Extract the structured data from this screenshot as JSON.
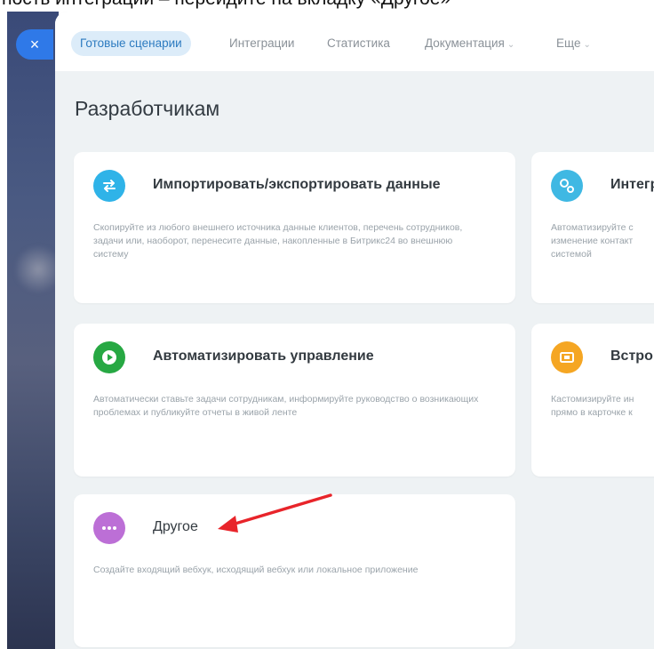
{
  "caption": "ность интеграции – перейдите на вкладку «Другое»",
  "close_button": {
    "glyph": "×"
  },
  "tabs": [
    {
      "label": "Готовые сценарии",
      "active": true
    },
    {
      "label": "Интеграции"
    },
    {
      "label": "Статистика"
    },
    {
      "label": "Документация",
      "chevron": "⌄"
    },
    {
      "label": "Еще",
      "chevron": "⌄"
    }
  ],
  "page_title": "Разработчикам",
  "cards": [
    {
      "title": "Импортировать/экспортировать данные",
      "description": "Скопируйте из любого внешнего источника данные клиентов, перечень сотрудников, задачи или, наоборот, перенесите данные, накопленные в Битрикс24 во внешнюю систему",
      "icon": "arrows-swap-icon",
      "color": "#2fb3e8"
    },
    {
      "title": "Интегр",
      "description": "Автоматизируйте с изменение контакт системой",
      "icon": "gears-icon",
      "color": "#3fb8e3"
    },
    {
      "title": "Автоматизировать управление",
      "description": "Автоматически ставьте задачи сотрудникам, информируйте руководство о возникающих проблемах и публикуйте отчеты в живой ленте",
      "icon": "play-icon",
      "color": "#27a843"
    },
    {
      "title": "Встро",
      "description": "Кастомизируйте ин прямо в карточке к",
      "icon": "embed-icon",
      "color": "#f5a623"
    },
    {
      "title": "Другое",
      "description": "Создайте входящий вебхук, исходящий вебхук или локальное приложение",
      "icon": "more-dots-icon",
      "color": "#bc6fd6"
    }
  ],
  "annotation": {
    "color": "#e8242a"
  }
}
